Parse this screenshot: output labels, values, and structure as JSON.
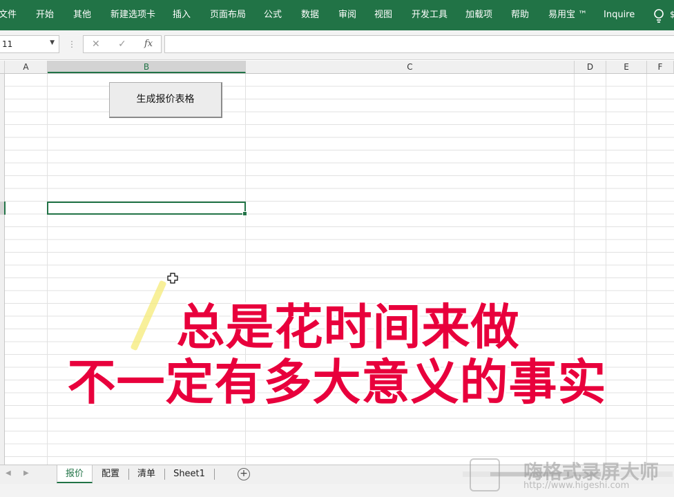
{
  "ribbon": {
    "tabs": [
      "文件",
      "开始",
      "其他",
      "新建选项卡",
      "插入",
      "页面布局",
      "公式",
      "数据",
      "审阅",
      "视图",
      "开发工具",
      "加载项",
      "帮助",
      "易用宝 ™",
      "Inquire"
    ],
    "trailing": "$"
  },
  "formula_bar": {
    "name_box": "11",
    "cancel_symbol": "✕",
    "enter_symbol": "✓",
    "fx_symbol": "fx",
    "formula": ""
  },
  "columns": [
    "A",
    "B",
    "C",
    "D",
    "E",
    "F"
  ],
  "sheet": {
    "macro_button_label": "生成报价表格"
  },
  "caption": {
    "line1": "总是花时间来做",
    "line2": "不一定有多大意义的事实"
  },
  "sheet_tabs": [
    "报价",
    "配置",
    "清单",
    "Sheet1"
  ],
  "watermark": {
    "name": "嗨格式录屏大师",
    "url": "http://www.higeshi.com"
  },
  "colors": {
    "accent": "#217346",
    "caption": "#e8003c"
  }
}
